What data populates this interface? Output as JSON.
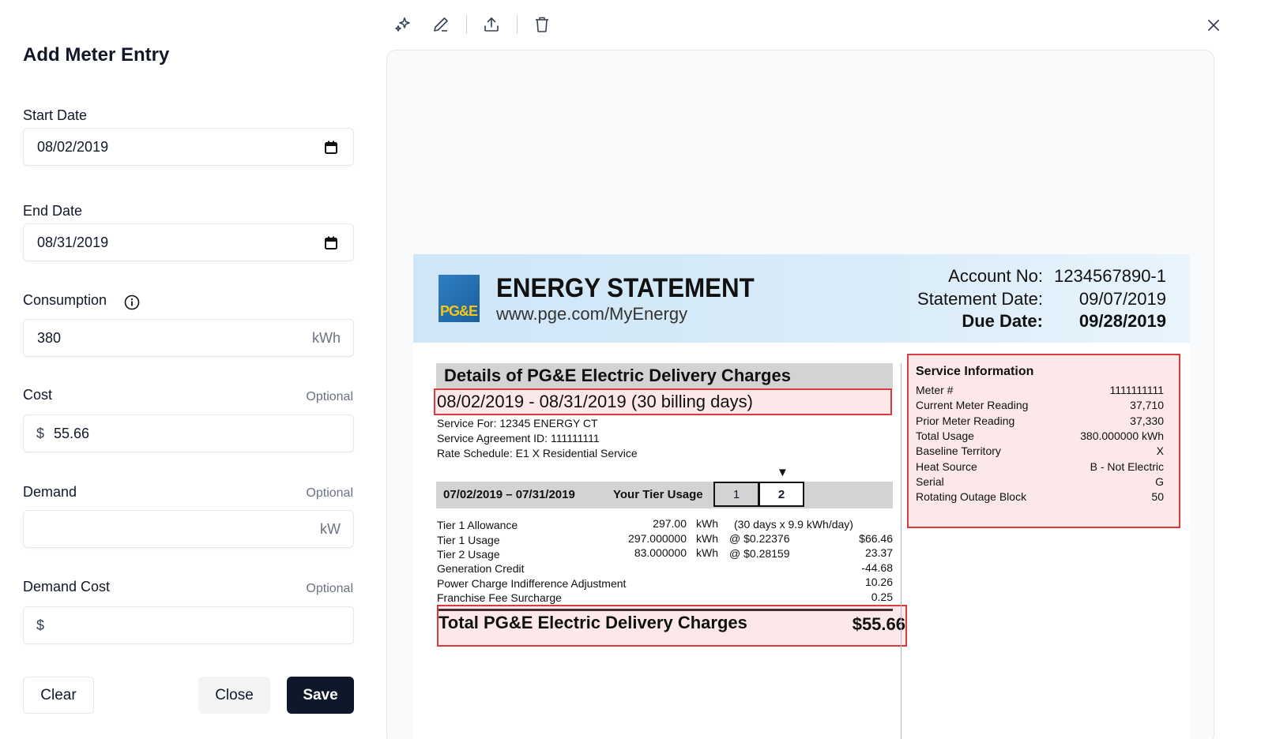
{
  "form": {
    "title": "Add Meter Entry",
    "start_date": {
      "label": "Start Date",
      "value": "08/02/2019",
      "icon": "calendar-icon"
    },
    "end_date": {
      "label": "End Date",
      "value": "08/31/2019",
      "icon": "calendar-icon"
    },
    "consumption": {
      "label": "Consumption",
      "value": "380",
      "unit": "kWh",
      "icon": "info-icon"
    },
    "cost": {
      "label": "Cost",
      "optional": "Optional",
      "prefix": "$",
      "value": "55.66"
    },
    "demand": {
      "label": "Demand",
      "optional": "Optional",
      "value": "",
      "unit": "kW"
    },
    "demand_cost": {
      "label": "Demand Cost",
      "optional": "Optional",
      "prefix": "$",
      "value": ""
    },
    "buttons": {
      "clear": "Clear",
      "close": "Close",
      "save": "Save"
    }
  },
  "toolbar": {
    "icons": [
      "sparkles-icon",
      "pencil-icon",
      "upload-icon",
      "trash-icon"
    ],
    "close_icon": "close-icon"
  },
  "bill": {
    "logo_text": "PG&E",
    "title": "ENERGY STATEMENT",
    "url": "www.pge.com/MyEnergy",
    "account_label": "Account No:",
    "account_no": "1234567890-1",
    "statement_date_label": "Statement Date:",
    "statement_date": "09/07/2019",
    "due_date_label": "Due Date:",
    "due_date": "09/28/2019",
    "details_title": "Details of PG&E Electric Delivery Charges",
    "period": "08/02/2019 - 08/31/2019 (30 billing days)",
    "service_for": "Service For:  12345 ENERGY CT",
    "service_agreement": "Service Agreement ID:  111111111",
    "rate_schedule": "Rate Schedule:  E1 X Residential Service",
    "tier_marker": "▼",
    "tier_period": "07/02/2019 – 07/31/2019",
    "tier_usage_label": "Your Tier Usage",
    "tier_1": "1",
    "tier_2": "2",
    "lines": [
      {
        "label": "Tier 1 Allowance",
        "qty": "297.00",
        "unit": "kWh",
        "rate": "(30 days x 9.9 kWh/day)",
        "amount": ""
      },
      {
        "label": "Tier 1 Usage",
        "qty": "297.000000",
        "unit": "kWh",
        "rate": "@ $0.22376",
        "amount": "$66.46"
      },
      {
        "label": "Tier 2 Usage",
        "qty": "83.000000",
        "unit": "kWh",
        "rate": "@ $0.28159",
        "amount": "23.37"
      },
      {
        "label": "Generation Credit",
        "qty": "",
        "unit": "",
        "rate": "",
        "amount": "-44.68"
      },
      {
        "label": "Power Charge Indifference Adjustment",
        "qty": "",
        "unit": "",
        "rate": "",
        "amount": "10.26"
      },
      {
        "label": "Franchise Fee Surcharge",
        "qty": "",
        "unit": "",
        "rate": "",
        "amount": "0.25"
      }
    ],
    "total_label": "Total PG&E Electric Delivery Charges",
    "total_amount": "$55.66",
    "service_info": {
      "title": "Service Information",
      "rows": [
        {
          "label": "Meter #",
          "value": "1111111111"
        },
        {
          "label": "Current Meter Reading",
          "value": "37,710"
        },
        {
          "label": "Prior Meter Reading",
          "value": "37,330"
        },
        {
          "label": "Total Usage",
          "value": "380.000000 kWh"
        },
        {
          "label": "Baseline Territory",
          "value": "X"
        },
        {
          "label": "Heat Source",
          "value": "B - Not Electric"
        },
        {
          "label": "Serial",
          "value": "G"
        },
        {
          "label": "Rotating Outage Block",
          "value": "50"
        }
      ]
    }
  },
  "colors": {
    "primary_button": "#0f172a",
    "highlight_border": "#d93a3a",
    "bill_header": "#d9ecf9"
  }
}
